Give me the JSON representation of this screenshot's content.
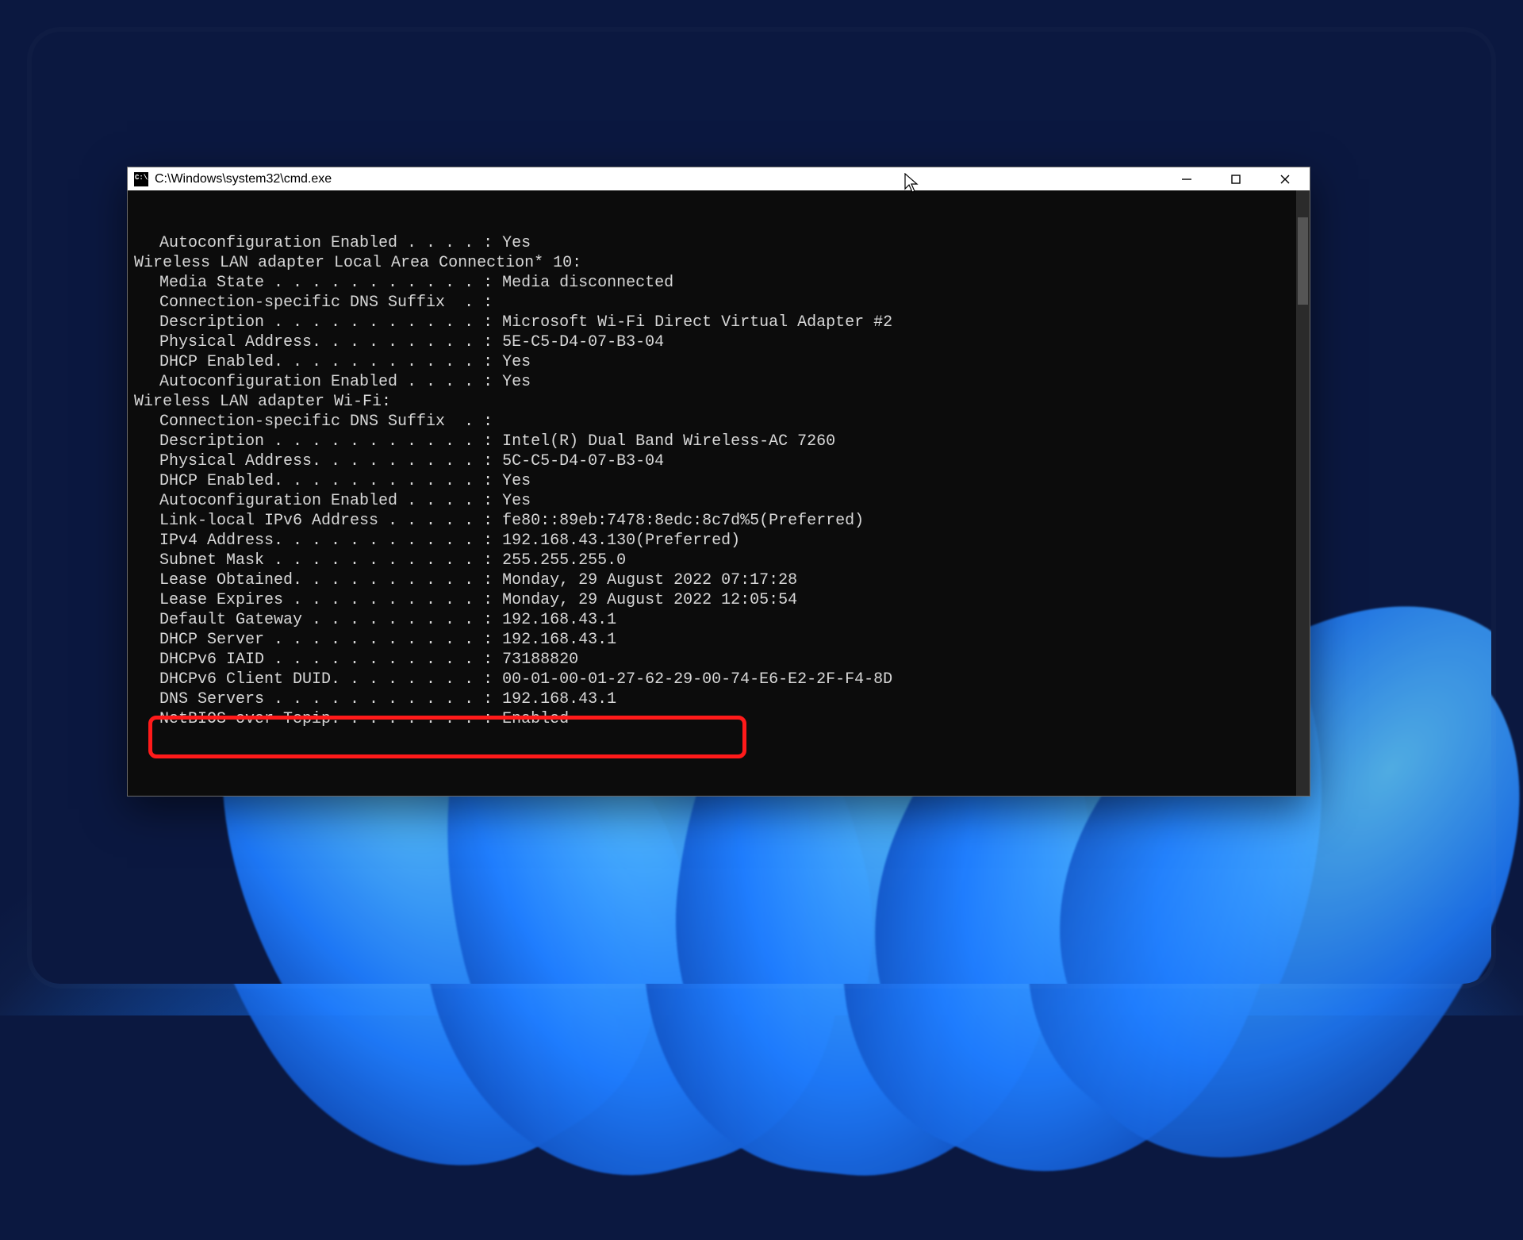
{
  "window": {
    "title": "C:\\Windows\\system32\\cmd.exe"
  },
  "terminal": {
    "lines": [
      {
        "cls": "indent1",
        "text": "Autoconfiguration Enabled . . . . : Yes"
      },
      {
        "cls": "",
        "text": ""
      },
      {
        "cls": "",
        "text": "Wireless LAN adapter Local Area Connection* 10:"
      },
      {
        "cls": "",
        "text": ""
      },
      {
        "cls": "indent1",
        "text": "Media State . . . . . . . . . . . : Media disconnected"
      },
      {
        "cls": "indent1",
        "text": "Connection-specific DNS Suffix  . :"
      },
      {
        "cls": "indent1",
        "text": "Description . . . . . . . . . . . : Microsoft Wi-Fi Direct Virtual Adapter #2"
      },
      {
        "cls": "indent1",
        "text": "Physical Address. . . . . . . . . : 5E-C5-D4-07-B3-04"
      },
      {
        "cls": "indent1",
        "text": "DHCP Enabled. . . . . . . . . . . : Yes"
      },
      {
        "cls": "indent1",
        "text": "Autoconfiguration Enabled . . . . : Yes"
      },
      {
        "cls": "",
        "text": ""
      },
      {
        "cls": "",
        "text": "Wireless LAN adapter Wi-Fi:"
      },
      {
        "cls": "",
        "text": ""
      },
      {
        "cls": "indent1",
        "text": "Connection-specific DNS Suffix  . :"
      },
      {
        "cls": "indent1",
        "text": "Description . . . . . . . . . . . : Intel(R) Dual Band Wireless-AC 7260"
      },
      {
        "cls": "indent1",
        "text": "Physical Address. . . . . . . . . : 5C-C5-D4-07-B3-04"
      },
      {
        "cls": "indent1",
        "text": "DHCP Enabled. . . . . . . . . . . : Yes"
      },
      {
        "cls": "indent1",
        "text": "Autoconfiguration Enabled . . . . : Yes"
      },
      {
        "cls": "indent1",
        "text": "Link-local IPv6 Address . . . . . : fe80::89eb:7478:8edc:8c7d%5(Preferred)"
      },
      {
        "cls": "indent1",
        "text": "IPv4 Address. . . . . . . . . . . : 192.168.43.130(Preferred)"
      },
      {
        "cls": "indent1",
        "text": "Subnet Mask . . . . . . . . . . . : 255.255.255.0"
      },
      {
        "cls": "indent1",
        "text": "Lease Obtained. . . . . . . . . . : Monday, 29 August 2022 07:17:28"
      },
      {
        "cls": "indent1",
        "text": "Lease Expires . . . . . . . . . . : Monday, 29 August 2022 12:05:54"
      },
      {
        "cls": "indent1",
        "text": "Default Gateway . . . . . . . . . : 192.168.43.1"
      },
      {
        "cls": "indent1",
        "text": "DHCP Server . . . . . . . . . . . : 192.168.43.1"
      },
      {
        "cls": "indent1",
        "text": "DHCPv6 IAID . . . . . . . . . . . : 73188820"
      },
      {
        "cls": "indent1",
        "text": "DHCPv6 Client DUID. . . . . . . . : 00-01-00-01-27-62-29-00-74-E6-E2-2F-F4-8D"
      },
      {
        "cls": "indent1",
        "text": "DNS Servers . . . . . . . . . . . : 192.168.43.1"
      },
      {
        "cls": "indent1",
        "text": "NetBIOS over Tcpip. . . . . . . . : Enabled"
      }
    ]
  },
  "callout": {
    "highlighted_field": "DNS Servers",
    "highlighted_value": "192.168.43.1"
  }
}
